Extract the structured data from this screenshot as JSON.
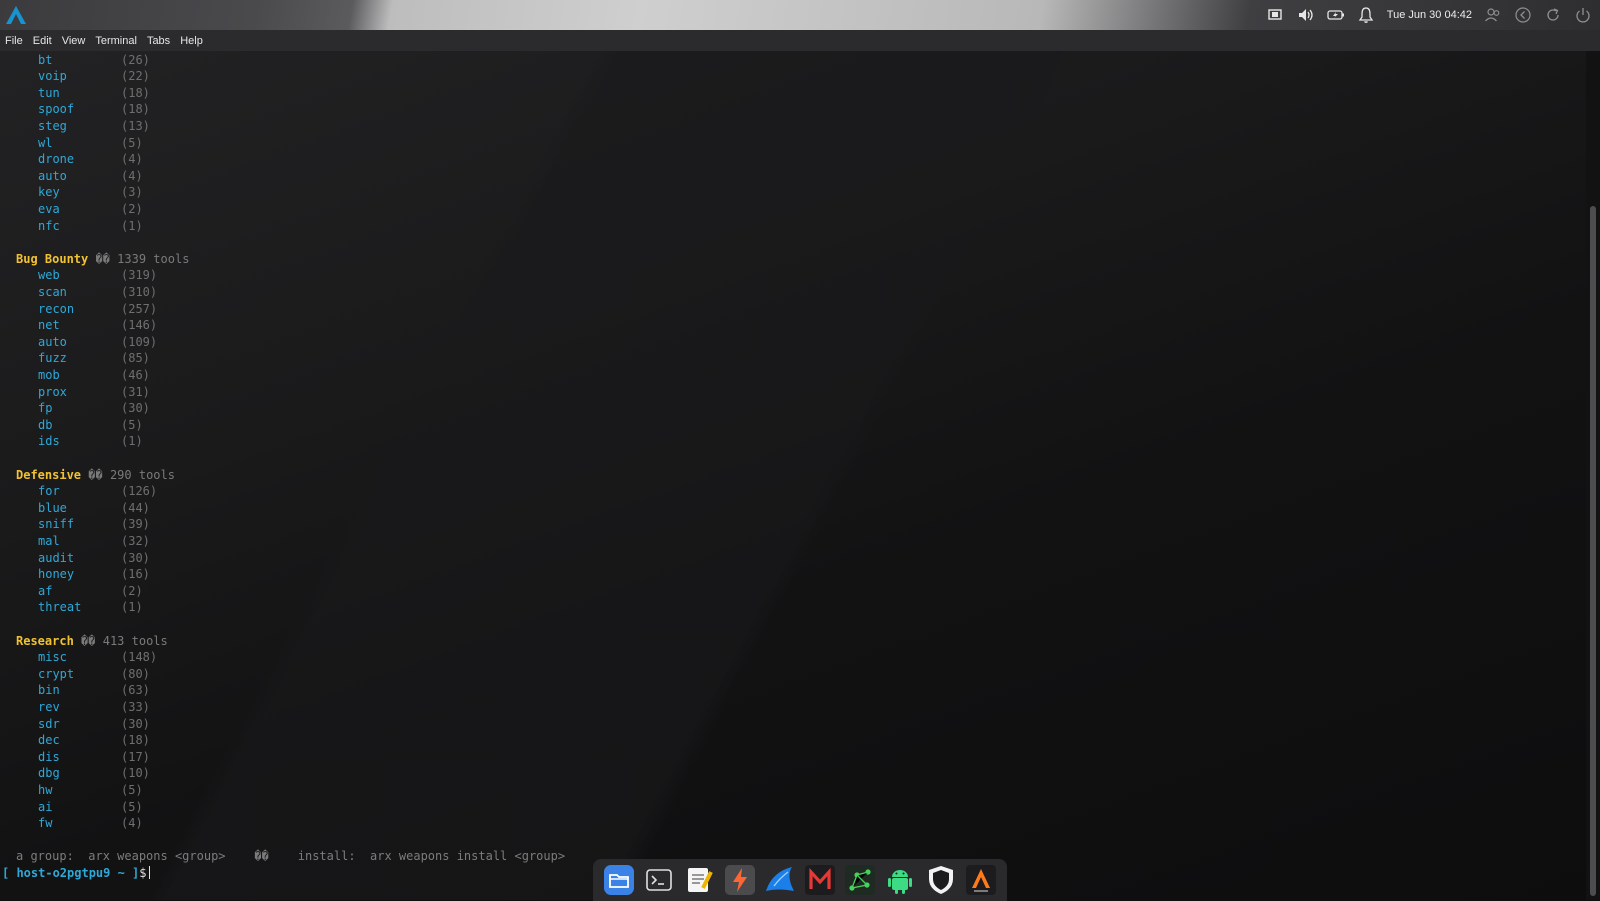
{
  "top_panel": {
    "clock": "Tue Jun 30  04:42",
    "tray_icons": [
      "screen-icon",
      "volume-icon",
      "battery-icon",
      "bell-icon"
    ],
    "session_icons": [
      "users-icon",
      "back-icon",
      "refresh-icon",
      "power-icon"
    ]
  },
  "menu": [
    "File",
    "Edit",
    "View",
    "Terminal",
    "Tabs",
    "Help"
  ],
  "terminal": {
    "first_list": [
      {
        "name": "bt",
        "count": "(26)"
      },
      {
        "name": "voip",
        "count": "(22)"
      },
      {
        "name": "tun",
        "count": "(18)"
      },
      {
        "name": "spoof",
        "count": "(18)"
      },
      {
        "name": "steg",
        "count": "(13)"
      },
      {
        "name": "wl",
        "count": "(5)"
      },
      {
        "name": "drone",
        "count": "(4)"
      },
      {
        "name": "auto",
        "count": "(4)"
      },
      {
        "name": "key",
        "count": "(3)"
      },
      {
        "name": "eva",
        "count": "(2)"
      },
      {
        "name": "nfc",
        "count": "(1)"
      }
    ],
    "categories": [
      {
        "title": "Bug Bounty",
        "sep": "��",
        "count": "1339 tools",
        "items": [
          {
            "name": "web",
            "count": "(319)"
          },
          {
            "name": "scan",
            "count": "(310)"
          },
          {
            "name": "recon",
            "count": "(257)"
          },
          {
            "name": "net",
            "count": "(146)"
          },
          {
            "name": "auto",
            "count": "(109)"
          },
          {
            "name": "fuzz",
            "count": "(85)"
          },
          {
            "name": "mob",
            "count": "(46)"
          },
          {
            "name": "prox",
            "count": "(31)"
          },
          {
            "name": "fp",
            "count": "(30)"
          },
          {
            "name": "db",
            "count": "(5)"
          },
          {
            "name": "ids",
            "count": "(1)"
          }
        ]
      },
      {
        "title": "Defensive",
        "sep": "��",
        "count": "290 tools",
        "items": [
          {
            "name": "for",
            "count": "(126)"
          },
          {
            "name": "blue",
            "count": "(44)"
          },
          {
            "name": "sniff",
            "count": "(39)"
          },
          {
            "name": "mal",
            "count": "(32)"
          },
          {
            "name": "audit",
            "count": "(30)"
          },
          {
            "name": "honey",
            "count": "(16)"
          },
          {
            "name": "af",
            "count": "(2)"
          },
          {
            "name": "threat",
            "count": "(1)"
          }
        ]
      },
      {
        "title": "Research",
        "sep": "��",
        "count": "413 tools",
        "items": [
          {
            "name": "misc",
            "count": "(148)"
          },
          {
            "name": "crypt",
            "count": "(80)"
          },
          {
            "name": "bin",
            "count": "(63)"
          },
          {
            "name": "rev",
            "count": "(33)"
          },
          {
            "name": "sdr",
            "count": "(30)"
          },
          {
            "name": "dec",
            "count": "(18)"
          },
          {
            "name": "dis",
            "count": "(17)"
          },
          {
            "name": "dbg",
            "count": "(10)"
          },
          {
            "name": "hw",
            "count": "(5)"
          },
          {
            "name": "ai",
            "count": "(5)"
          },
          {
            "name": "fw",
            "count": "(4)"
          }
        ]
      }
    ],
    "hint": "a group:  arx weapons <group>    ��    install:  arx weapons install <group>",
    "prompt": "[ host-o2pgtpu9 ~ ]",
    "prompt_symbol": "$"
  },
  "dock": {
    "icons": [
      "file-manager-icon",
      "terminal-icon",
      "text-editor-icon",
      "burp-suite-icon",
      "wireshark-icon",
      "metasploit-icon",
      "maltego-icon",
      "android-icon",
      "shield-icon",
      "arch-app-icon"
    ]
  },
  "colors": {
    "category": "#f1c232",
    "tool": "#2ea8d8",
    "count": "#6f6f6f"
  }
}
